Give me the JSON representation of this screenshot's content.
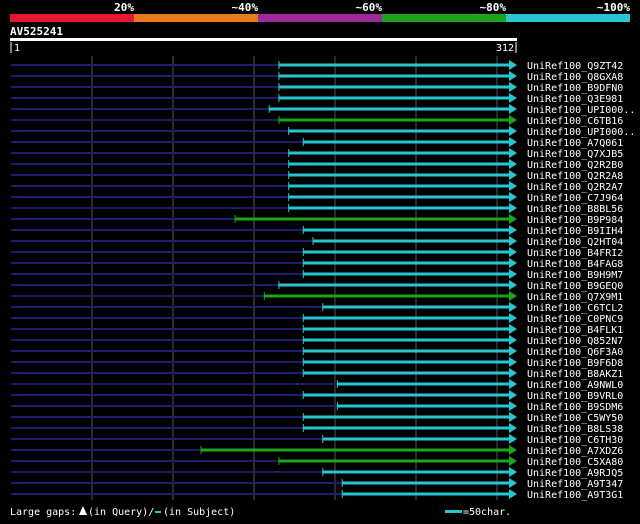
{
  "query": {
    "name": "AV525241",
    "start_label": "1",
    "end_label": "312",
    "length": 312
  },
  "identity_scale": {
    "bins": [
      {
        "label": "20%",
        "color": "#e0192e"
      },
      {
        "label": "~40%",
        "color": "#e8781e"
      },
      {
        "label": "~60%",
        "color": "#9b2a9b"
      },
      {
        "label": "~80%",
        "color": "#1aa51a"
      },
      {
        "label": "~100%",
        "color": "#27c6d0"
      }
    ]
  },
  "colors": {
    "background": "#000000",
    "query_line": "#ffffff",
    "unaligned": "#1c1c6a",
    "grid": "#555555",
    "identity_100": "#27c6d0",
    "identity_80": "#1aa51a",
    "gap_marker": "#ffffff"
  },
  "hits": [
    {
      "id": "UniRef100_Q9ZT42",
      "q_start": 166,
      "color_key": "identity_100"
    },
    {
      "id": "UniRef100_Q8GXA8",
      "q_start": 166,
      "color_key": "identity_100"
    },
    {
      "id": "UniRef100_B9DFN0",
      "q_start": 166,
      "color_key": "identity_100"
    },
    {
      "id": "UniRef100_Q3E981",
      "q_start": 166,
      "color_key": "identity_100"
    },
    {
      "id": "UniRef100_UPI000..",
      "q_start": 160,
      "color_key": "identity_100"
    },
    {
      "id": "UniRef100_C6TB16",
      "q_start": 166,
      "color_key": "identity_80"
    },
    {
      "id": "UniRef100_UPI000..",
      "q_start": 172,
      "color_key": "identity_100"
    },
    {
      "id": "UniRef100_A7Q061",
      "q_start": 181,
      "color_key": "identity_100"
    },
    {
      "id": "UniRef100_Q7XJB5",
      "q_start": 172,
      "color_key": "identity_100"
    },
    {
      "id": "UniRef100_Q2R2B0",
      "q_start": 172,
      "color_key": "identity_100"
    },
    {
      "id": "UniRef100_Q2R2A8",
      "q_start": 172,
      "color_key": "identity_100"
    },
    {
      "id": "UniRef100_Q2R2A7",
      "q_start": 172,
      "color_key": "identity_100"
    },
    {
      "id": "UniRef100_C7J964",
      "q_start": 172,
      "color_key": "identity_100"
    },
    {
      "id": "UniRef100_B8BL56",
      "q_start": 172,
      "color_key": "identity_100"
    },
    {
      "id": "UniRef100_B9P984",
      "q_start": 139,
      "color_key": "identity_80"
    },
    {
      "id": "UniRef100_B9IIH4",
      "q_start": 181,
      "color_key": "identity_100"
    },
    {
      "id": "UniRef100_Q2HT04",
      "q_start": 187,
      "color_key": "identity_100"
    },
    {
      "id": "UniRef100_B4FRI2",
      "q_start": 181,
      "color_key": "identity_100"
    },
    {
      "id": "UniRef100_B4FAG8",
      "q_start": 181,
      "color_key": "identity_100"
    },
    {
      "id": "UniRef100_B9H9M7",
      "q_start": 181,
      "color_key": "identity_100"
    },
    {
      "id": "UniRef100_B9GEQ0",
      "q_start": 166,
      "color_key": "identity_100"
    },
    {
      "id": "UniRef100_Q7X9M1",
      "q_start": 157,
      "color_key": "identity_80"
    },
    {
      "id": "UniRef100_C6TCL2",
      "q_start": 193,
      "color_key": "identity_100"
    },
    {
      "id": "UniRef100_C0PNC9",
      "q_start": 181,
      "color_key": "identity_100"
    },
    {
      "id": "UniRef100_B4FLK1",
      "q_start": 181,
      "color_key": "identity_100"
    },
    {
      "id": "UniRef100_Q852N7",
      "q_start": 181,
      "color_key": "identity_100"
    },
    {
      "id": "UniRef100_Q6F3A0",
      "q_start": 181,
      "color_key": "identity_100"
    },
    {
      "id": "UniRef100_B9F6D8",
      "q_start": 181,
      "color_key": "identity_100"
    },
    {
      "id": "UniRef100_B8AKZ1",
      "q_start": 181,
      "color_key": "identity_100"
    },
    {
      "id": "UniRef100_A9NWL0",
      "q_start": 202,
      "color_key": "identity_100"
    },
    {
      "id": "UniRef100_B9VRL0",
      "q_start": 181,
      "color_key": "identity_100"
    },
    {
      "id": "UniRef100_B9SDM6",
      "q_start": 202,
      "color_key": "identity_100"
    },
    {
      "id": "UniRef100_C5WY50",
      "q_start": 181,
      "color_key": "identity_100"
    },
    {
      "id": "UniRef100_B8LS38",
      "q_start": 181,
      "color_key": "identity_100"
    },
    {
      "id": "UniRef100_C6TH30",
      "q_start": 193,
      "color_key": "identity_100"
    },
    {
      "id": "UniRef100_A7XDZ6",
      "q_start": 118,
      "color_key": "identity_80"
    },
    {
      "id": "UniRef100_C5XA80",
      "q_start": 166,
      "color_key": "identity_80"
    },
    {
      "id": "UniRef100_A9RJQ5",
      "q_start": 193,
      "color_key": "identity_100"
    },
    {
      "id": "UniRef100_A9T347",
      "q_start": 205,
      "color_key": "identity_100"
    },
    {
      "id": "UniRef100_A9T3G1",
      "q_start": 205,
      "color_key": "identity_100"
    }
  ],
  "footer": {
    "gaps_label": "Large gaps:",
    "query_gap_text": "(in Query)/",
    "subject_gap_text": "(in Subject)",
    "scale_text": "=50char."
  }
}
